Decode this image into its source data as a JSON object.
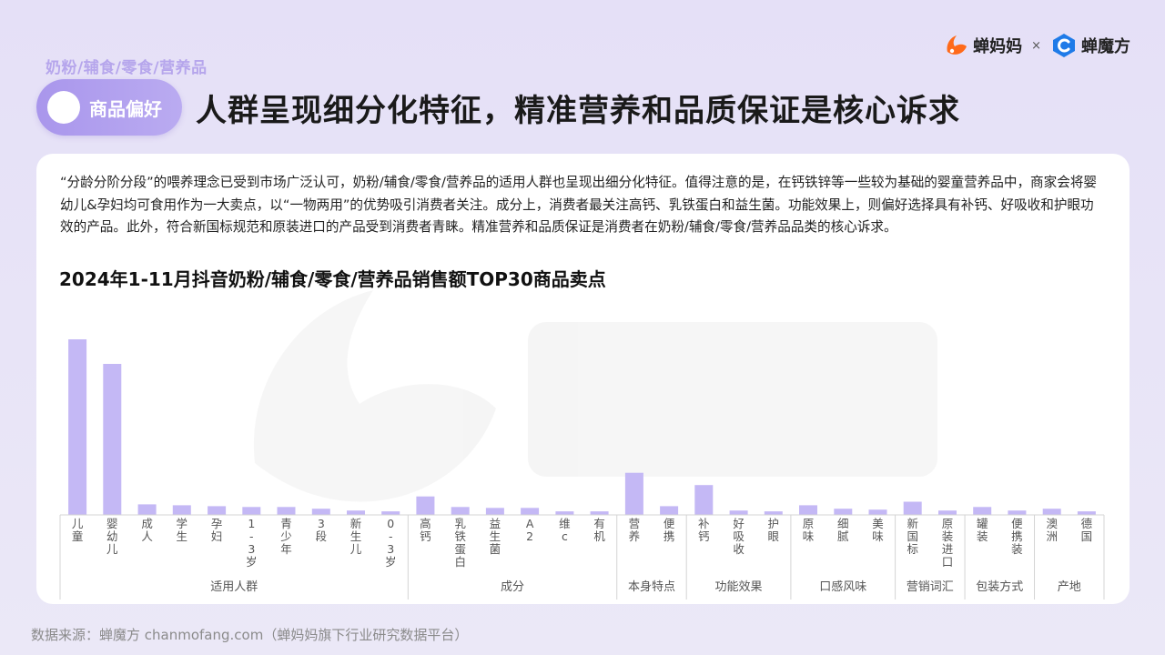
{
  "header": {
    "category": "奶粉/辅食/零食/营养品",
    "section": "商品偏好",
    "title": "人群呈现细分化特征，精准营养和品质保证是核心诉求"
  },
  "logos": {
    "brand1": "蝉妈妈",
    "separator": "×",
    "brand2": "蝉魔方"
  },
  "intro": "“分龄分阶分段”的喂养理念已受到市场广泛认可，奶粉/辅食/零食/营养品的适用人群也呈现出细分化特征。值得注意的是，在钙铁锌等一些较为基础的婴童营养品中，商家会将婴幼儿&孕妇均可食用作为一大卖点，以“一物两用”的优势吸引消费者关注。成分上，消费者最关注高钙、乳铁蛋白和益生菌。功能效果上，则偏好选择具有补钙、好吸收和护眼功效的产品。此外，符合新国标规范和原装进口的产品受到消费者青睐。精准营养和品质保证是消费者在奶粉/辅食/零食/营养品品类的核心诉求。",
  "chart_data": {
    "type": "bar",
    "title": "2024年1-11月抖音奶粉/辅食/零食/营养品销售额TOP30商品卖点",
    "xlabel": "",
    "ylabel": "",
    "ylim": [
      0,
      100
    ],
    "grid": false,
    "bar_color": "#c4b8f5",
    "categories": [
      "儿童",
      "婴幼儿",
      "成人",
      "学生",
      "孕妇",
      "1-3岁",
      "青少年",
      "3段",
      "新生儿",
      "0-3岁",
      "高钙",
      "乳铁蛋白",
      "益生菌",
      "A2",
      "维c",
      "有机",
      "营养",
      "便携",
      "补钙",
      "好吸收",
      "护眼",
      "原味",
      "细腻",
      "美味",
      "新国标",
      "原装进口",
      "罐装",
      "便携装",
      "澳洲",
      "德国"
    ],
    "values": [
      100,
      86,
      6,
      5.5,
      5,
      4.5,
      4.5,
      3.5,
      2.5,
      2,
      10.5,
      4.5,
      4,
      4,
      2,
      2,
      24,
      5,
      17,
      2.5,
      2,
      5.5,
      3.5,
      3,
      7.5,
      2.5,
      4.5,
      2.5,
      3.5,
      2
    ],
    "groups": [
      {
        "name": "适用人群",
        "count": 10
      },
      {
        "name": "成分",
        "count": 6
      },
      {
        "name": "本身特点",
        "count": 2
      },
      {
        "name": "功能效果",
        "count": 3
      },
      {
        "name": "口感风味",
        "count": 3
      },
      {
        "name": "营销词汇",
        "count": 2
      },
      {
        "name": "包装方式",
        "count": 2
      },
      {
        "name": "产地",
        "count": 2
      }
    ]
  },
  "footer": {
    "source": "数据来源：蝉魔方 chanmofang.com（蝉妈妈旗下行业研究数据平台）"
  }
}
